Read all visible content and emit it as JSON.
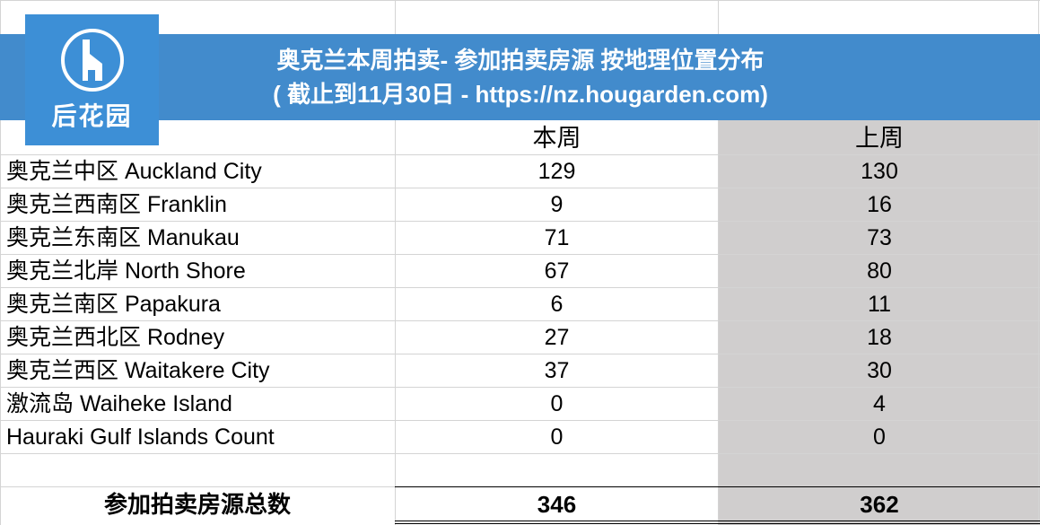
{
  "logo": {
    "icon": "hougarden-house-h-icon",
    "text": "后花园"
  },
  "header": {
    "title_line1": "奥克兰本周拍卖- 参加拍卖房源 按地理位置分布",
    "title_line2": "( 截止到11月30日 - https://nz.hougarden.com)"
  },
  "colors": {
    "banner": "#428bcc",
    "logo_bg": "#3d8fd6",
    "last_week_bg": "#d0cece"
  },
  "table": {
    "columns": [
      "",
      "本周",
      "上周"
    ],
    "rows": [
      {
        "region": "奥克兰中区 Auckland City",
        "this_week": "129",
        "last_week": "130"
      },
      {
        "region": "奥克兰西南区 Franklin",
        "this_week": "9",
        "last_week": "16"
      },
      {
        "region": "奥克兰东南区 Manukau",
        "this_week": "71",
        "last_week": "73"
      },
      {
        "region": "奥克兰北岸 North Shore",
        "this_week": "67",
        "last_week": "80"
      },
      {
        "region": "奥克兰南区 Papakura",
        "this_week": "6",
        "last_week": "11"
      },
      {
        "region": "奥克兰西北区 Rodney",
        "this_week": "27",
        "last_week": "18"
      },
      {
        "region": "奥克兰西区 Waitakere City",
        "this_week": "37",
        "last_week": "30"
      },
      {
        "region": "激流岛 Waiheke Island",
        "this_week": "0",
        "last_week": "4"
      },
      {
        "region": "Hauraki Gulf Islands Count",
        "this_week": "0",
        "last_week": "0"
      }
    ],
    "total": {
      "label": "参加拍卖房源总数",
      "this_week": "346",
      "last_week": "362"
    }
  }
}
